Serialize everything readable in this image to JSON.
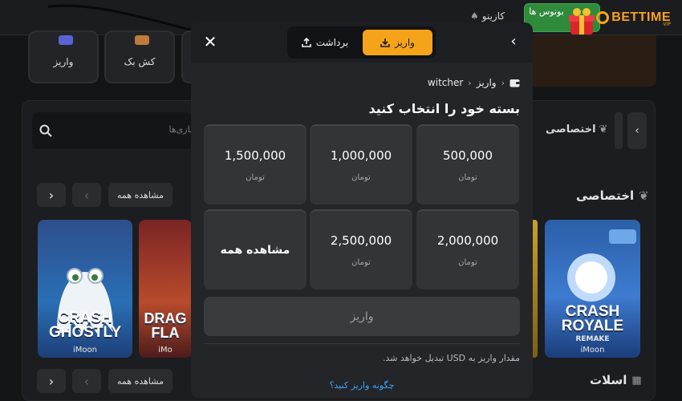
{
  "topbar": {
    "logo_text": "BETTIME",
    "logo_sub": "VIP",
    "bonus_label": "بونوس ها",
    "casino_label": "کازینو"
  },
  "quick_cards": [
    {
      "label": "واریز"
    },
    {
      "label": "کش بک"
    }
  ],
  "lobby": {
    "search_placeholder": "بازی‌ها",
    "tab_exclusive": "اختصاصی",
    "section_exclusive": "اختصاصی",
    "section_slots": "اسلات",
    "see_all": "مشاهده همه",
    "nav_prev": "‹",
    "nav_next": "›"
  },
  "games": [
    {
      "title": "CRASH GHOSTLY",
      "provider": "iMoon"
    },
    {
      "title": "DRAG FLA",
      "provider": "iMo"
    },
    {
      "title": "CRASH ROYALE",
      "subtitle": "REMAKE",
      "provider": "iMoon"
    }
  ],
  "modal": {
    "tab_deposit": "واریز",
    "tab_withdraw": "برداشت",
    "breadcrumb_root": "واریز",
    "breadcrumb_current": "witcher",
    "title": "بسته خود را انتخاب کنید",
    "currency": "تومان",
    "packages": [
      {
        "amount": "500,000"
      },
      {
        "amount": "1,000,000"
      },
      {
        "amount": "1,500,000"
      },
      {
        "amount": "2,000,000"
      },
      {
        "amount": "2,500,000"
      }
    ],
    "see_all": "مشاهده همه",
    "deposit_button": "واریز",
    "note": "مقدار واریز به USD تبدیل خواهد شد.",
    "help_link": "چگونه واریز کنید؟"
  }
}
